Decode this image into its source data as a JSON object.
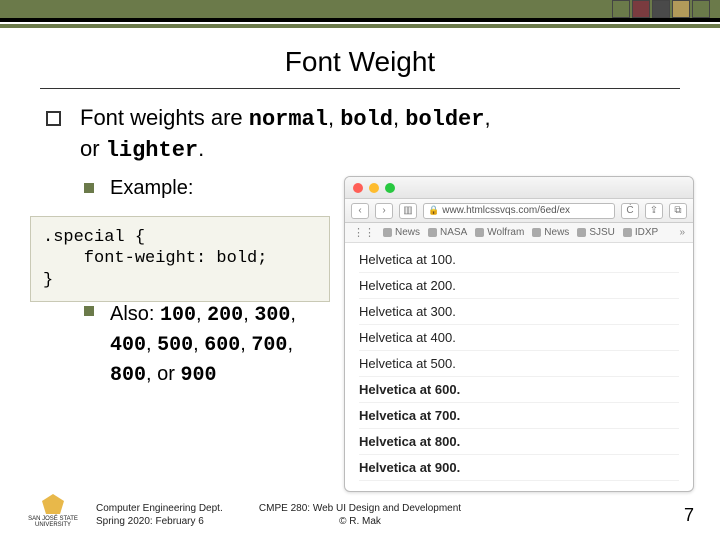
{
  "title": "Font Weight",
  "bullets": {
    "main_pre": "Font weights are ",
    "kw1": "normal",
    "kw2": "bold",
    "kw3": "bolder",
    "kw4": "lighter",
    "or": ", or ",
    "example": "Example:",
    "also_pre": "Also: ",
    "nums": [
      "100",
      "200",
      "300",
      "400",
      "500",
      "600",
      "700",
      "800",
      "900"
    ],
    "also_or": ", or "
  },
  "code": ".special {\n    font-weight: bold;\n}",
  "browser": {
    "url": "www.htmlcssvqs.com/6ed/ex",
    "bookmarks": [
      "News",
      "NASA",
      "Wolfram",
      "News",
      "SJSU",
      "IDXP"
    ],
    "rows": [
      {
        "label": "Helvetica at 100.",
        "cls": "w100"
      },
      {
        "label": "Helvetica at 200.",
        "cls": "w200"
      },
      {
        "label": "Helvetica at 300.",
        "cls": "w300"
      },
      {
        "label": "Helvetica at 400.",
        "cls": "w400"
      },
      {
        "label": "Helvetica at 500.",
        "cls": "w500"
      },
      {
        "label": "Helvetica at 600.",
        "cls": "w600"
      },
      {
        "label": "Helvetica at 700.",
        "cls": "w700"
      },
      {
        "label": "Helvetica at 800.",
        "cls": "w800"
      },
      {
        "label": "Helvetica at 900.",
        "cls": "w900"
      }
    ]
  },
  "footer": {
    "logo_text": "SAN JOSÉ STATE\nUNIVERSITY",
    "left_line1": "Computer Engineering Dept.",
    "left_line2": "Spring 2020: February 6",
    "center_line1": "CMPE 280: Web UI Design and Development",
    "center_line2": "© R. Mak",
    "page": "7"
  }
}
